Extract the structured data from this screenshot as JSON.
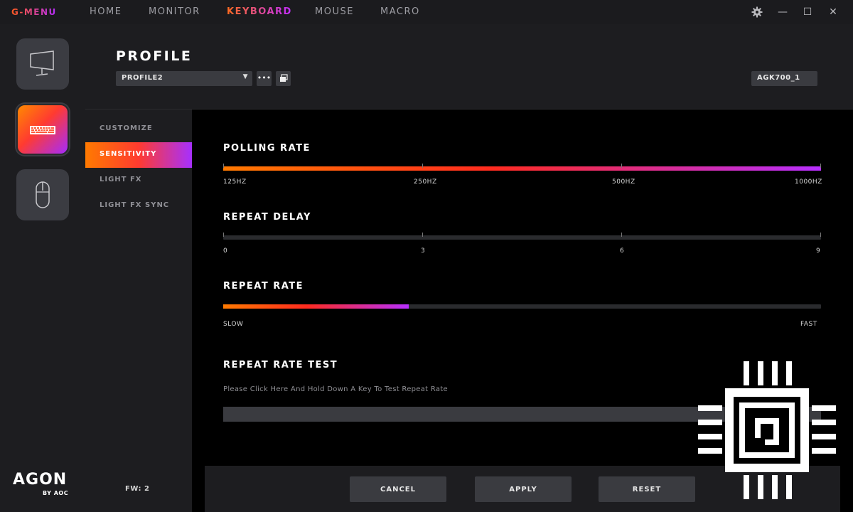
{
  "app": {
    "brand": "G-MENU"
  },
  "nav": [
    "HOME",
    "MONITOR",
    "KEYBOARD",
    "MOUSE",
    "MACRO"
  ],
  "nav_active": "KEYBOARD",
  "window": {
    "minimize": "—",
    "maximize": "☐",
    "close": "✕"
  },
  "profile": {
    "title": "PROFILE",
    "selected": "PROFILE2",
    "more_label": "•••",
    "device": "AGK700_1"
  },
  "subnav": {
    "items": [
      "CUSTOMIZE",
      "SENSITIVITY",
      "LIGHT FX",
      "LIGHT FX SYNC"
    ],
    "active": "SENSITIVITY",
    "fw": "FW: 2"
  },
  "logo": {
    "name": "AGON",
    "sub": "BY AOC"
  },
  "polling_rate": {
    "title": "POLLING RATE",
    "labels": [
      "125HZ",
      "250HZ",
      "500HZ",
      "1000HZ"
    ],
    "selected_index": 3
  },
  "repeat_delay": {
    "title": "REPEAT DELAY",
    "labels": [
      "0",
      "3",
      "6",
      "9"
    ],
    "value": 0
  },
  "repeat_rate": {
    "title": "REPEAT RATE",
    "min_label": "SLOW",
    "max_label": "FAST",
    "value_fraction": 0.31
  },
  "repeat_test": {
    "title": "REPEAT RATE TEST",
    "hint": "Please Click Here And Hold Down A Key To Test Repeat Rate"
  },
  "buttons": {
    "cancel": "CANCEL",
    "apply": "APPLY",
    "reset": "RESET"
  },
  "colors": {
    "accent_start": "#ff7a00",
    "accent_mid": "#ff2b1f",
    "accent_end": "#b72fff",
    "panel": "#1d1d20"
  }
}
